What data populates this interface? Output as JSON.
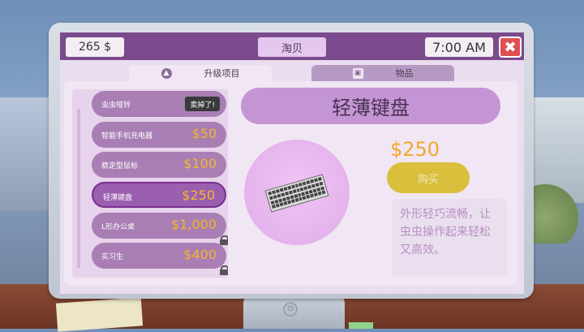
{
  "topbar": {
    "money": "265 $",
    "store_name": "淘贝",
    "time": "7:00 AM",
    "close_icon": "✖"
  },
  "tabs": {
    "upgrades": "升级项目",
    "items": "物品"
  },
  "upgrades": [
    {
      "name": "虫虫哑铃",
      "status": "卖掉了!",
      "locked": false
    },
    {
      "name": "智能手机充电器",
      "price": "$50",
      "locked": false
    },
    {
      "name": "稳定型鼠标",
      "price": "$100",
      "locked": false
    },
    {
      "name": "轻薄键盘",
      "price": "$250",
      "locked": false,
      "selected": true
    },
    {
      "name": "L形办公桌",
      "price": "$1,000",
      "locked": true
    },
    {
      "name": "实习生",
      "price": "$400",
      "locked": true
    }
  ],
  "product": {
    "title": "轻薄键盘",
    "price": "$250",
    "buy_label": "购买",
    "description": "外形轻巧流畅，让虫虫操作起来轻松又高效。",
    "icon": "keyboard-icon"
  },
  "colors": {
    "accent": "#7b4a8c",
    "price": "#f2a92c",
    "buy": "#d9bf3b",
    "close": "#e04f4f"
  }
}
